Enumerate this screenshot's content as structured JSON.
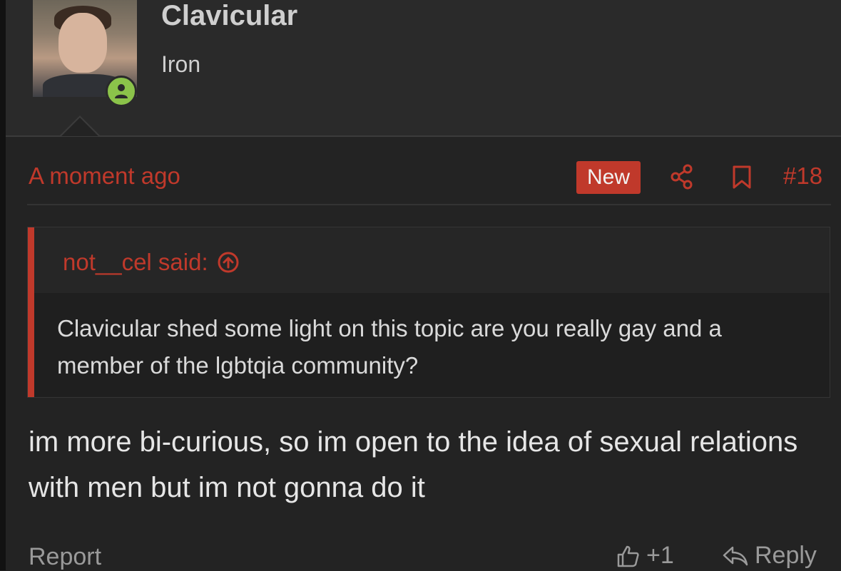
{
  "user": {
    "name": "Clavicular",
    "title": "Iron",
    "online": true
  },
  "post": {
    "time": "A moment ago",
    "new_label": "New",
    "number": "#18",
    "quote": {
      "author": "not__cel said:",
      "text": "Clavicular shed some light on this topic are you really gay and a member of the lgbtqia community?"
    },
    "body": "im more bi-curious, so im open to the idea of sexual relations with men but im not gonna do it"
  },
  "footer": {
    "report_label": "Report",
    "like_count": "+1",
    "reply_label": "Reply"
  },
  "colors": {
    "accent": "#c0392b",
    "online": "#8bc34a",
    "background": "#232323"
  },
  "icons": [
    "person-icon",
    "share-icon",
    "bookmark-icon",
    "arrow-up-circle-icon",
    "thumbs-up-icon",
    "reply-icon"
  ]
}
